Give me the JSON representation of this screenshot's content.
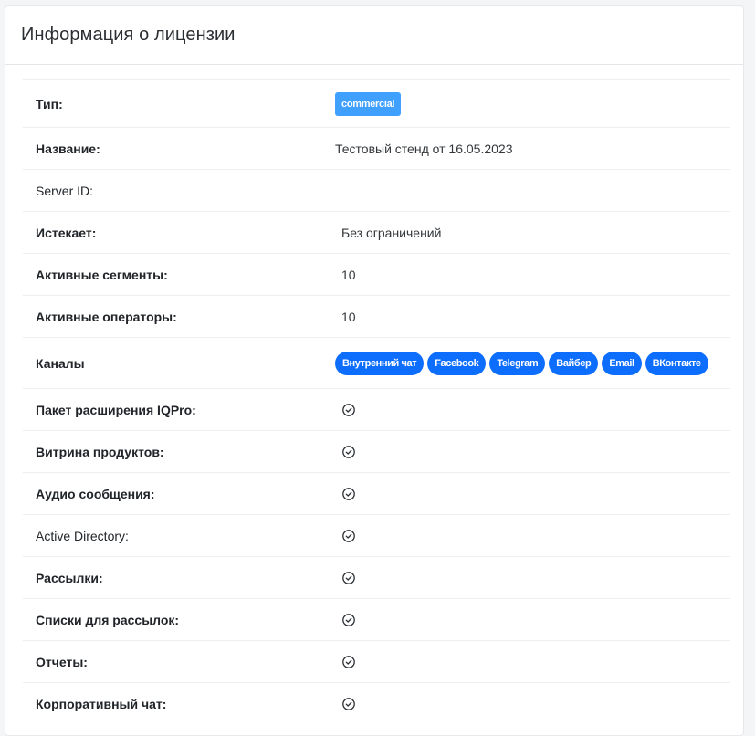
{
  "header": {
    "title": "Информация о лицензии"
  },
  "license": {
    "type": {
      "label": "Тип:",
      "value": "commercial"
    },
    "name": {
      "label": "Название:",
      "value": "Тестовый стенд от 16.05.2023"
    },
    "server_id": {
      "label": "Server ID:",
      "value": ""
    },
    "expires": {
      "label": "Истекает:",
      "value": "Без ограничений"
    },
    "active_segments": {
      "label": "Активные сегменты:",
      "value": "10"
    },
    "active_operators": {
      "label": "Активные операторы:",
      "value": "10"
    },
    "channels": {
      "label": "Каналы",
      "items": [
        "Внутренний чат",
        "Facebook",
        "Telegram",
        "Вайбер",
        "Email",
        "ВКонтакте"
      ]
    },
    "features": [
      {
        "label": "Пакет расширения IQPro:",
        "enabled": true,
        "icon": "check-circle-icon"
      },
      {
        "label": "Витрина продуктов:",
        "enabled": true,
        "icon": "check-circle-icon"
      },
      {
        "label": "Аудио сообщения:",
        "enabled": true,
        "icon": "check-circle-icon"
      },
      {
        "label": "Active Directory:",
        "enabled": true,
        "icon": "check-circle-icon"
      },
      {
        "label": "Рассылки:",
        "enabled": true,
        "icon": "check-circle-icon"
      },
      {
        "label": "Списки для рассылок:",
        "enabled": true,
        "icon": "check-circle-icon"
      },
      {
        "label": "Отчеты:",
        "enabled": true,
        "icon": "check-circle-icon"
      },
      {
        "label": "Корпоративный чат:",
        "enabled": true,
        "icon": "check-circle-icon"
      }
    ]
  },
  "colors": {
    "type_badge": "#3fa0ff",
    "channel_pill": "#0d6efd"
  }
}
